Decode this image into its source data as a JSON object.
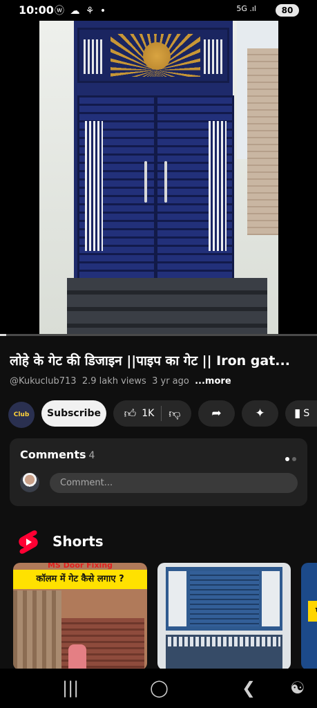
{
  "status": {
    "time": "10:00",
    "left_icons": "ⓦ ☁ ⚘ •",
    "right_icons": "5G .ıl",
    "battery": "80"
  },
  "video": {
    "progress": 0.02
  },
  "info": {
    "title": "लोहे के गेट की डिजाइन ||पाइप का गेट || Iron gat...",
    "channel": "@Kukuclub713",
    "views": "2.9 lakh views",
    "age": "3 yr ago",
    "more": "...more"
  },
  "actions": {
    "channel_avatar_text": "Club",
    "subscribe": "Subscribe",
    "like_count": "1K",
    "save_partial": "S"
  },
  "comments": {
    "heading": "Comments",
    "count": "4",
    "placeholder": "Comment..."
  },
  "shorts": {
    "heading": "Shorts",
    "items": [
      {
        "tag": "MS Door Fixing",
        "banner": "कॉलम में गेट कैसे लगाए ?"
      },
      {},
      {
        "banner": "पै"
      }
    ]
  },
  "icons": {
    "like": "like-icon",
    "dislike": "dislike-icon",
    "share": "share-icon",
    "remix": "sparkle-icon",
    "save": "save-icon",
    "nav_recents": "recents-icon",
    "nav_home": "home-icon",
    "nav_back": "back-icon",
    "nav_accessibility": "accessibility-icon"
  },
  "colors": {
    "background": "#0f0f0f",
    "shorts_red": "#ff0033",
    "subscribe_bg": "#f1f1f1"
  }
}
